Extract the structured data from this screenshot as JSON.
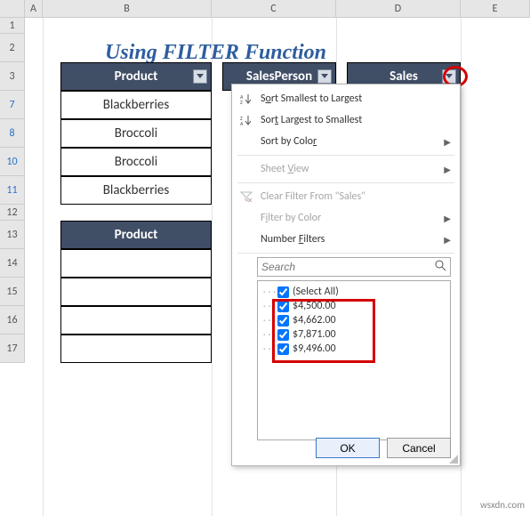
{
  "columns": [
    "A",
    "B",
    "C",
    "D",
    "E"
  ],
  "rows": [
    "1",
    "2",
    "3",
    "7",
    "8",
    "10",
    "11",
    "12",
    "13",
    "14",
    "15",
    "16",
    "17"
  ],
  "title": "Using FILTER Function",
  "table1": {
    "headers": {
      "product": "Product",
      "salesperson": "SalesPerson",
      "sales": "Sales"
    },
    "data": [
      {
        "product": "Blackberries"
      },
      {
        "product": "Broccoli"
      },
      {
        "product": "Broccoli"
      },
      {
        "product": "Blackberries"
      }
    ]
  },
  "table2": {
    "header": "Product"
  },
  "menu": {
    "sort_asc": "Sort Smallest to Largest",
    "sort_desc": "Sort Largest to Smallest",
    "sort_color": "Sort by Color",
    "sheet_view": "Sheet View",
    "clear": "Clear Filter From \"Sales\"",
    "filter_color": "Filter by Color",
    "number_filters": "Number Filters",
    "search_placeholder": "Search",
    "select_all": "(Select All)",
    "items": [
      "$4,500.00",
      "$4,662.00",
      "$7,871.00",
      "$9,496.00"
    ],
    "ok": "OK",
    "cancel": "Cancel"
  },
  "watermark": "wsxdn.com",
  "colors": {
    "header_bg": "#404e66",
    "accent": "#2e5d9e",
    "highlight": "#d40000"
  }
}
